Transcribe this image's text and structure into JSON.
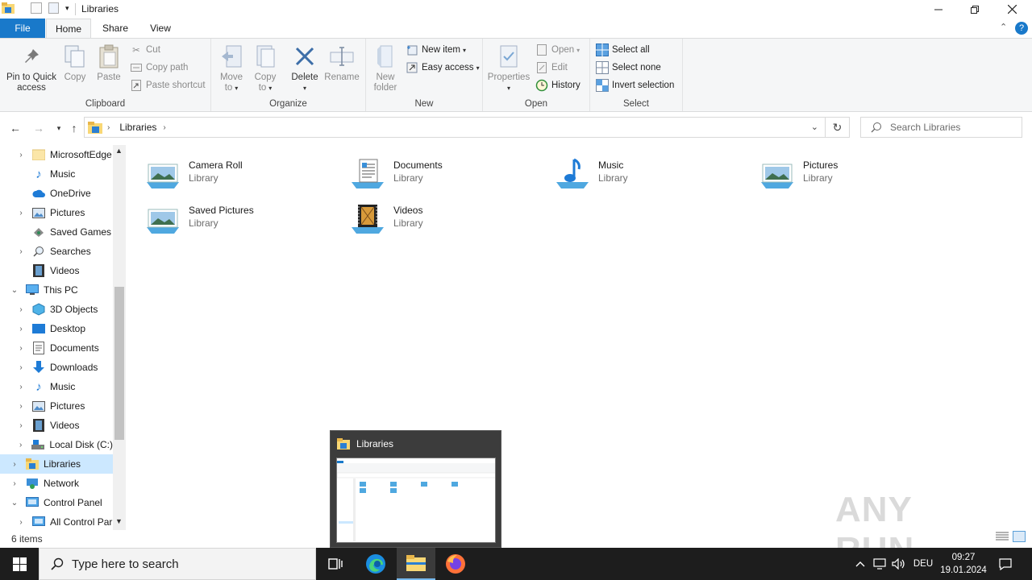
{
  "window": {
    "title": "Libraries",
    "controls": [
      "minimize",
      "restore",
      "close"
    ]
  },
  "ribbon_tabs": [
    {
      "label": "File"
    },
    {
      "label": "Home"
    },
    {
      "label": "Share"
    },
    {
      "label": "View"
    }
  ],
  "ribbon": {
    "clipboard": {
      "group_label": "Clipboard",
      "pin_label_1": "Pin to Quick",
      "pin_label_2": "access",
      "copy_label": "Copy",
      "paste_label": "Paste",
      "cut_label": "Cut",
      "copy_path_label": "Copy path",
      "paste_shortcut_label": "Paste shortcut"
    },
    "organize": {
      "group_label": "Organize",
      "move_to_1": "Move",
      "move_to_2": "to",
      "copy_to_1": "Copy",
      "copy_to_2": "to",
      "delete_label": "Delete",
      "rename_label": "Rename"
    },
    "new": {
      "group_label": "New",
      "new_folder_1": "New",
      "new_folder_2": "folder",
      "new_item_label": "New item",
      "easy_access_label": "Easy access"
    },
    "open": {
      "group_label": "Open",
      "properties_label": "Properties",
      "open_label": "Open",
      "edit_label": "Edit",
      "history_label": "History"
    },
    "select": {
      "group_label": "Select",
      "select_all_label": "Select all",
      "select_none_label": "Select none",
      "invert_label": "Invert selection"
    }
  },
  "address": {
    "path": "Libraries",
    "search_placeholder": "Search Libraries"
  },
  "nav_pane": {
    "items": [
      {
        "label": "MicrosoftEdge",
        "icon": "folder-icon"
      },
      {
        "label": "Music",
        "icon": "music-icon"
      },
      {
        "label": "OneDrive",
        "icon": "cloud-icon"
      },
      {
        "label": "Pictures",
        "icon": "pictures-icon"
      },
      {
        "label": "Saved Games",
        "icon": "games-icon"
      },
      {
        "label": "Searches",
        "icon": "search-icon"
      },
      {
        "label": "Videos",
        "icon": "videos-icon"
      },
      {
        "label": "This PC",
        "icon": "computer-icon"
      },
      {
        "label": "3D Objects",
        "icon": "cube-icon"
      },
      {
        "label": "Desktop",
        "icon": "desktop-icon"
      },
      {
        "label": "Documents",
        "icon": "documents-icon"
      },
      {
        "label": "Downloads",
        "icon": "download-icon"
      },
      {
        "label": "Music",
        "icon": "music-icon"
      },
      {
        "label": "Pictures",
        "icon": "pictures-icon"
      },
      {
        "label": "Videos",
        "icon": "videos-icon"
      },
      {
        "label": "Local Disk (C:)",
        "icon": "disk-icon"
      },
      {
        "label": "Libraries",
        "icon": "libraries-icon"
      },
      {
        "label": "Network",
        "icon": "network-icon"
      },
      {
        "label": "Control Panel",
        "icon": "control-panel-icon"
      },
      {
        "label": "All Control Par",
        "icon": "control-panel-icon"
      }
    ]
  },
  "libraries": [
    {
      "name": "Camera Roll",
      "type": "Library",
      "icon": "pictures-library-icon"
    },
    {
      "name": "Documents",
      "type": "Library",
      "icon": "documents-library-icon"
    },
    {
      "name": "Music",
      "type": "Library",
      "icon": "music-library-icon"
    },
    {
      "name": "Pictures",
      "type": "Library",
      "icon": "pictures-library-icon"
    },
    {
      "name": "Saved Pictures",
      "type": "Library",
      "icon": "pictures-library-icon"
    },
    {
      "name": "Videos",
      "type": "Library",
      "icon": "videos-library-icon"
    }
  ],
  "status": {
    "item_count": "6 items"
  },
  "popup": {
    "title": "Libraries"
  },
  "watermark": "ANY RUN",
  "taskbar": {
    "search_placeholder": "Type here to search",
    "language": "DEU",
    "time": "09:27",
    "date": "19.01.2024"
  },
  "colors": {
    "accent": "#1979ca",
    "selection": "#cce8ff",
    "taskbar": "#1d1d1d"
  }
}
